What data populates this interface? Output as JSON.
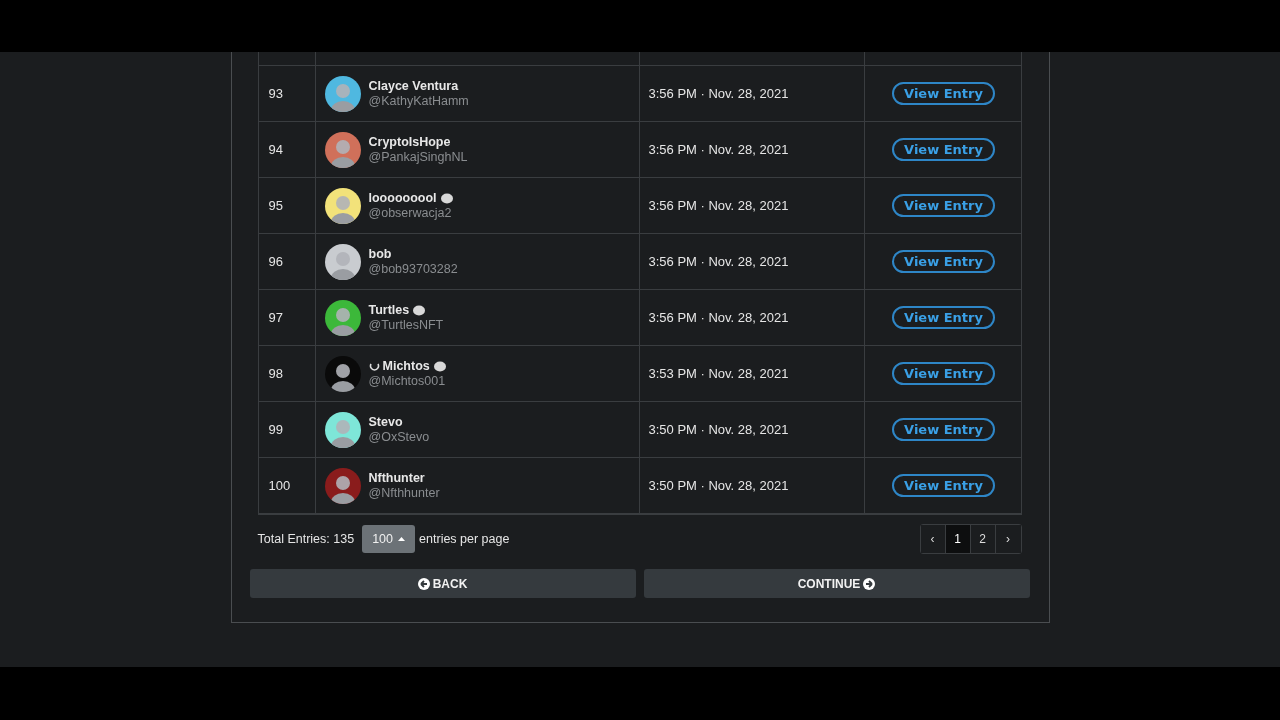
{
  "entries": [
    {
      "rank": "93",
      "name": "Clayce Ventura",
      "handle": "@KathyKatHamm",
      "time": "3:56 PM · Nov. 28, 2021",
      "action": "View Entry",
      "color": "#4fb8e0",
      "leading_mark": false,
      "trailing_mark": false
    },
    {
      "rank": "94",
      "name": "CryptoIsHope",
      "handle": "@PankajSinghNL",
      "time": "3:56 PM · Nov. 28, 2021",
      "action": "View Entry",
      "color": "#d0705a",
      "leading_mark": false,
      "trailing_mark": false
    },
    {
      "rank": "95",
      "name": "looooooool",
      "handle": "@obserwacja2",
      "time": "3:56 PM · Nov. 28, 2021",
      "action": "View Entry",
      "color": "#f2e27a",
      "leading_mark": false,
      "trailing_mark": true
    },
    {
      "rank": "96",
      "name": "bob",
      "handle": "@bob93703282",
      "time": "3:56 PM · Nov. 28, 2021",
      "action": "View Entry",
      "color": "#c9ccd0",
      "leading_mark": false,
      "trailing_mark": false
    },
    {
      "rank": "97",
      "name": "Turtles",
      "handle": "@TurtlesNFT",
      "time": "3:56 PM · Nov. 28, 2021",
      "action": "View Entry",
      "color": "#3cb83a",
      "leading_mark": false,
      "trailing_mark": true
    },
    {
      "rank": "98",
      "name": "Michtos",
      "handle": "@Michtos001",
      "time": "3:53 PM · Nov. 28, 2021",
      "action": "View Entry",
      "color": "#0a0a0a",
      "leading_mark": true,
      "trailing_mark": true
    },
    {
      "rank": "99",
      "name": "Stevo",
      "handle": "@OxStevo",
      "time": "3:50 PM · Nov. 28, 2021",
      "action": "View Entry",
      "color": "#7ee6d8",
      "leading_mark": false,
      "trailing_mark": false
    },
    {
      "rank": "100",
      "name": "Nfthunter",
      "handle": "@Nfthhunter",
      "time": "3:50 PM · Nov. 28, 2021",
      "action": "View Entry",
      "color": "#8a1c1c",
      "leading_mark": false,
      "trailing_mark": false
    }
  ],
  "footer": {
    "total": "Total Entries: 135",
    "per_page": "100",
    "per_page_label": "entries per page",
    "pages": [
      {
        "label": "‹",
        "selected": false
      },
      {
        "label": "1",
        "selected": true
      },
      {
        "label": "2",
        "selected": false
      },
      {
        "label": "›",
        "selected": false
      }
    ]
  },
  "buttons": [
    {
      "label": "BACK",
      "kind": "back"
    },
    {
      "label": "CONTINUE",
      "kind": "continue"
    }
  ]
}
